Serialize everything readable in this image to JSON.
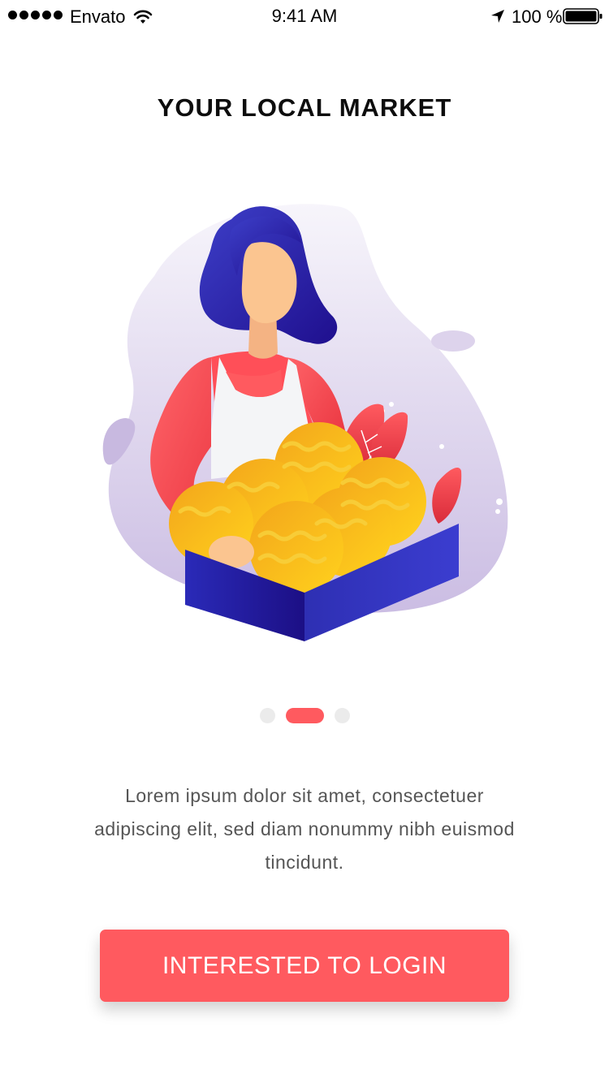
{
  "status_bar": {
    "carrier": "Envato",
    "time": "9:41 AM",
    "battery_percent": "100 %",
    "signal_icon": "signal-dots-icon",
    "wifi_icon": "wifi-icon",
    "location_icon": "location-arrow-icon",
    "battery_icon": "battery-icon"
  },
  "onboarding": {
    "title": "YOUR LOCAL MARKET",
    "illustration": "market-vendor-illustration",
    "description": "Lorem ipsum dolor sit amet, consectetuer adipiscing elit, sed diam nonummy nibh euismod tincidunt.",
    "pager": {
      "total_pages": 3,
      "active_page": 2
    }
  },
  "actions": {
    "login_label": "INTERESTED TO LOGIN"
  },
  "colors": {
    "accent": "#ff5a5f",
    "pager_inactive": "#ebebeb",
    "text_body": "#555555",
    "illustration_blue": "#2e2fb3",
    "illustration_purple": "#d0c3e6",
    "illustration_yellow": "#f8c21b"
  }
}
